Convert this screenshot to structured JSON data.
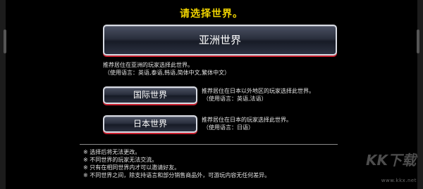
{
  "header": {
    "title": "请选择世界。"
  },
  "worlds": {
    "asia": {
      "button_label": "亚洲世界",
      "desc_line1": "推荐居住在亚洲的玩家选择此世界。",
      "desc_line2": "（使用语言：英语,泰语,韩语,简体中文,繁体中文）"
    },
    "international": {
      "button_label": "国际世界",
      "desc_line1": "推荐居住在日本以外地区的玩家选择此世界。",
      "desc_line2": "（使用语言：英语,法语）"
    },
    "japan": {
      "button_label": "日本世界",
      "desc_line1": "推荐居住在日本的玩家选择此世界。",
      "desc_line2": "（使用语言：日语）"
    }
  },
  "notes": [
    "※ 选择后将无法更改。",
    "※ 不同世界的玩家无法交流。",
    "※ 只有在相同世界内才可以邀请好友。",
    "※ 不同世界之间，除支持语言和部分销售商品外，可游玩内容无任何差异。"
  ],
  "watermark": {
    "url": "www.kkx.net",
    "logo": "KK下载"
  },
  "colors": {
    "title": "#f0d400",
    "button_accent": "#c81e2e",
    "background": "#000000"
  }
}
